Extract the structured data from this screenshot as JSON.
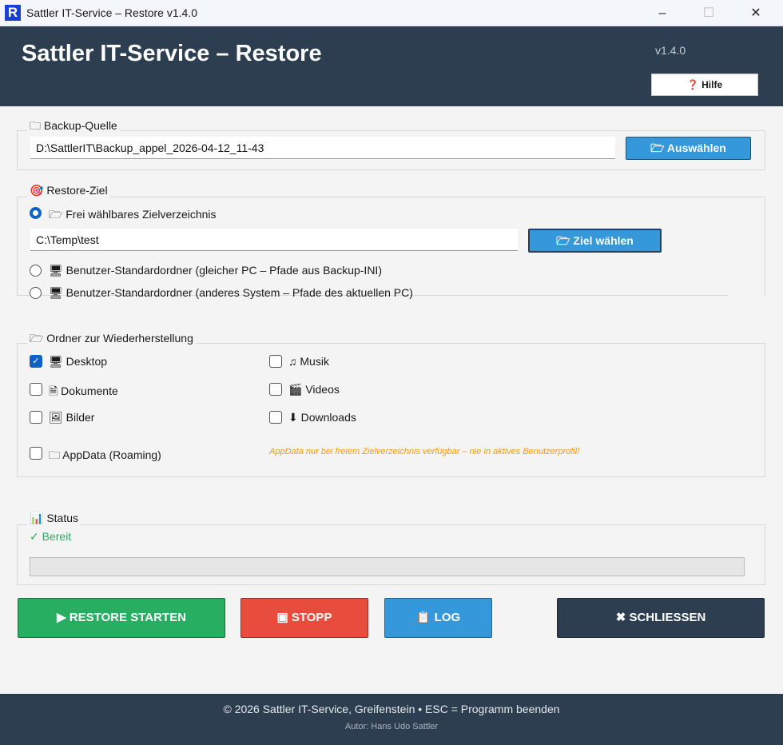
{
  "window": {
    "title": "Sattler IT-Service – Restore  v1.4.0",
    "icon_letter": "R",
    "minimize": "–",
    "maximize": "☐",
    "close": "✕"
  },
  "header": {
    "title": "Sattler IT-Service – Restore",
    "version": "v1.4.0",
    "help_label": "❓ Hilfe"
  },
  "source": {
    "label": "🗀 Backup-Quelle",
    "path": "D:\\SattlerIT\\Backup_appel_2026-04-12_11-43",
    "button": "🗁 Auswählen"
  },
  "target": {
    "label": "🎯 Restore-Ziel",
    "option_free": "🗁 Frei wählbares Zielverzeichnis",
    "path": "C:\\Temp\\test",
    "button": "🗁 Ziel wählen",
    "option_same": "🖥 Benutzer-Standardordner  (gleicher PC – Pfade aus Backup-INI)",
    "option_other": "🖥 Benutzer-Standardordner  (anderes System – Pfade des aktuellen PC)",
    "selected": "free"
  },
  "folders": {
    "label": "🗁 Ordner zur Wiederherstellung",
    "items": [
      {
        "label": "🖥 Desktop",
        "checked": true
      },
      {
        "label": "🗎 Dokumente",
        "checked": false
      },
      {
        "label": "🖼 Bilder",
        "checked": false
      },
      {
        "label": "♫ Musik",
        "checked": false
      },
      {
        "label": "🎬 Videos",
        "checked": false
      },
      {
        "label": "⬇ Downloads",
        "checked": false
      },
      {
        "label": "🗀 AppData (Roaming)",
        "checked": false
      }
    ],
    "appdata_note": "AppData nur bei freiem Zielverzeichnis verfügbar – nie in aktives Benutzerprofil!",
    "note_color": "#f39c12"
  },
  "status": {
    "label": "📊 Status",
    "text": "✓ Bereit",
    "progress": 0
  },
  "actions": {
    "start": "▶  RESTORE STARTEN",
    "stop": "▣  STOPP",
    "log": "📋  LOG",
    "close": "✖  SCHLIESSEN"
  },
  "footer": {
    "line1": "© 2026 Sattler IT-Service, Greifenstein  •  ESC = Programm beenden",
    "line2": "Autor: Hans Udo Sattler"
  }
}
